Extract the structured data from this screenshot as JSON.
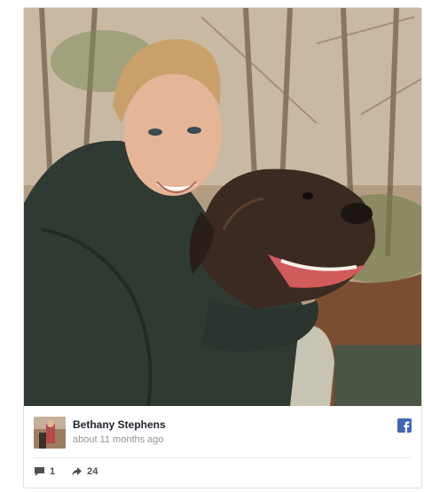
{
  "post": {
    "photo_icon": "photo-of-woman-with-dog",
    "author_name": "Bethany Stephens",
    "timestamp": "about 11 months ago",
    "platform_icon": "facebook-icon",
    "comment_icon": "comment-icon",
    "comment_count": "1",
    "share_icon": "share-icon",
    "share_count": "24",
    "colors": {
      "facebook_blue": "#4267b2",
      "name_text": "#1d2129",
      "meta_text": "#90949c",
      "border": "#dddfe2"
    }
  }
}
